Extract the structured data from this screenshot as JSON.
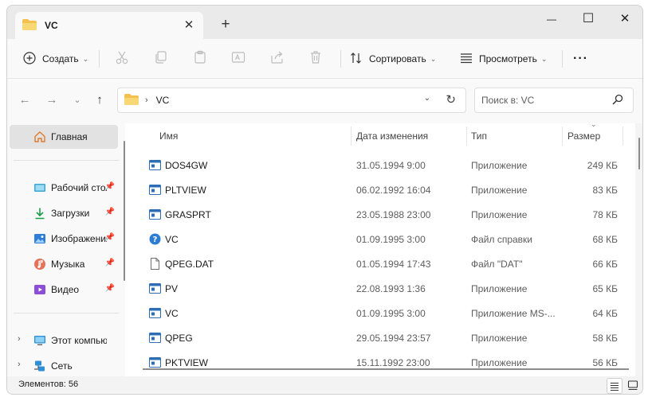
{
  "window": {
    "tab_title": "VC",
    "tab_close": "✕",
    "new_tab": "+",
    "minimize": "—",
    "maximize": "☐",
    "close": "✕"
  },
  "toolbar": {
    "create_label": "Создать",
    "sort_label": "Сортировать",
    "view_label": "Просмотреть",
    "more_label": "···"
  },
  "address": {
    "current_folder": "VC",
    "search_placeholder": "Поиск в: VC"
  },
  "sidebar": {
    "items": [
      {
        "label": "Главная",
        "icon": "home-icon"
      },
      {
        "label": "Рабочий стол",
        "icon": "desktop-icon",
        "pinned": true
      },
      {
        "label": "Загрузки",
        "icon": "downloads-icon",
        "pinned": true
      },
      {
        "label": "Изображения",
        "icon": "pictures-icon",
        "pinned": true
      },
      {
        "label": "Музыка",
        "icon": "music-icon",
        "pinned": true
      },
      {
        "label": "Видео",
        "icon": "videos-icon",
        "pinned": true
      },
      {
        "label": "Этот компьютер",
        "icon": "this-pc-icon"
      },
      {
        "label": "Сеть",
        "icon": "network-icon"
      }
    ]
  },
  "columns": {
    "name": "Имя",
    "date": "Дата изменения",
    "type": "Тип",
    "size": "Размер"
  },
  "files": [
    {
      "name": "DOS4GW",
      "date": "31.05.1994 9:00",
      "type": "Приложение",
      "size": "249 КБ",
      "icon": "app-icon"
    },
    {
      "name": "PLTVIEW",
      "date": "06.02.1992 16:04",
      "type": "Приложение",
      "size": "83 КБ",
      "icon": "app-icon"
    },
    {
      "name": "GRASPRT",
      "date": "23.05.1988 23:00",
      "type": "Приложение",
      "size": "78 КБ",
      "icon": "app-icon"
    },
    {
      "name": "VC",
      "date": "01.09.1995 3:00",
      "type": "Файл справки",
      "size": "68 КБ",
      "icon": "help-icon"
    },
    {
      "name": "QPEG.DAT",
      "date": "01.05.1994 17:43",
      "type": "Файл \"DAT\"",
      "size": "66 КБ",
      "icon": "file-icon"
    },
    {
      "name": "PV",
      "date": "22.08.1993 1:36",
      "type": "Приложение",
      "size": "65 КБ",
      "icon": "app-icon"
    },
    {
      "name": "VC",
      "date": "01.09.1995 3:00",
      "type": "Приложение MS-...",
      "size": "64 КБ",
      "icon": "app-icon"
    },
    {
      "name": "QPEG",
      "date": "29.05.1994 23:57",
      "type": "Приложение",
      "size": "58 КБ",
      "icon": "app-icon"
    },
    {
      "name": "PKTVIEW",
      "date": "15.11.1992 23:00",
      "type": "Приложение",
      "size": "56 КБ",
      "icon": "app-icon"
    }
  ],
  "status": {
    "item_count": "Элементов: 56"
  },
  "colors": {
    "accent": "#0067c0",
    "folder": "#f4c04e"
  }
}
